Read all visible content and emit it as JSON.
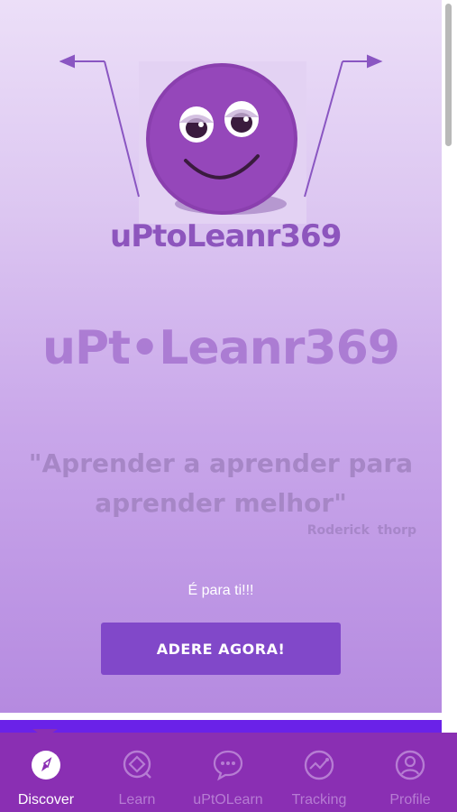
{
  "logo": {
    "small_text": "uPtoLeanr369"
  },
  "hero": {
    "title": "uPt•Leanr369",
    "quote": "\"Aprender a aprender para aprender melhor\"",
    "author": "Roderick thorp",
    "tagline": "É para ti!!!",
    "cta_label": "ADERE AGORA!"
  },
  "colors": {
    "accent": "#8148c9",
    "tabbar": "#8a2fb3",
    "tab_inactive": "#b67cd3"
  },
  "tabs": [
    {
      "label": "Discover",
      "icon": "compass-icon",
      "active": true
    },
    {
      "label": "Learn",
      "icon": "learn-icon",
      "active": false
    },
    {
      "label": "uPtOLearn",
      "icon": "chat-bubble-icon",
      "active": false
    },
    {
      "label": "Tracking",
      "icon": "tracking-icon",
      "active": false
    },
    {
      "label": "Profile",
      "icon": "profile-icon",
      "active": false
    }
  ]
}
